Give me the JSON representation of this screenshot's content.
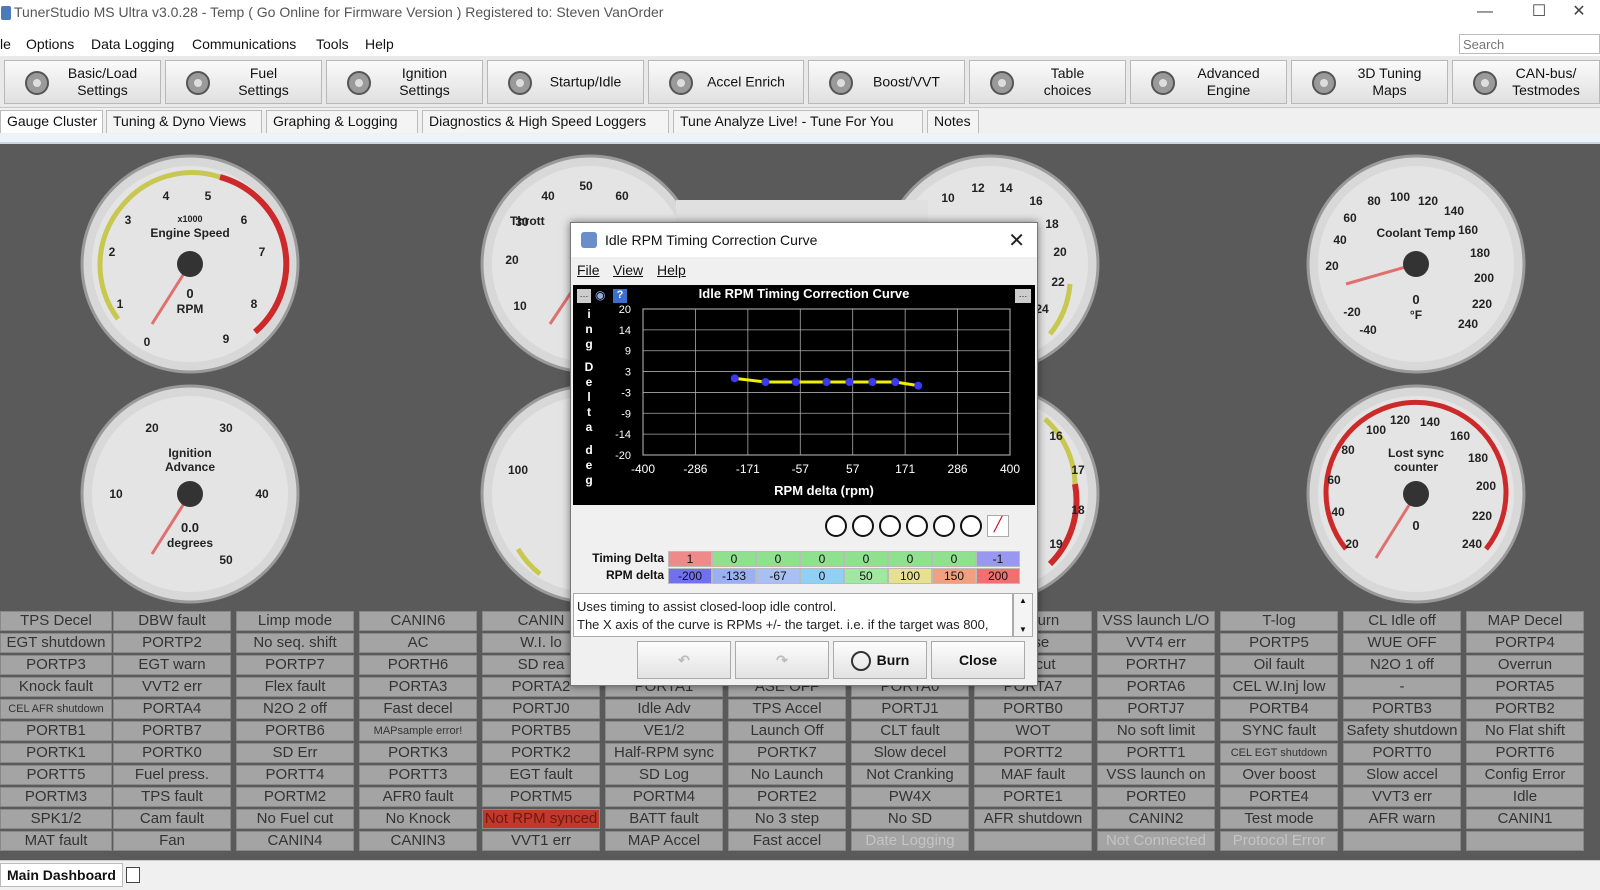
{
  "window": {
    "title": "TunerStudio MS Ultra v3.0.28 - Temp ( Go Online for Firmware Version ) Registered to: Steven VanOrder",
    "min": "—",
    "max": "☐",
    "close": "✕"
  },
  "menu": [
    "le",
    "Options",
    "Data Logging",
    "Communications",
    "Tools",
    "Help"
  ],
  "search": {
    "placeholder": "Search"
  },
  "toolbar": [
    {
      "l1": "Basic/Load",
      "l2": "Settings",
      "icon": "gear-icon"
    },
    {
      "l1": "Fuel",
      "l2": "Settings",
      "icon": "injector-icon"
    },
    {
      "l1": "Ignition",
      "l2": "Settings",
      "icon": "spark-plug-icon"
    },
    {
      "l1": "Startup/Idle",
      "l2": "",
      "icon": "wrench-icon"
    },
    {
      "l1": "Accel Enrich",
      "l2": "",
      "icon": "pedal-icon"
    },
    {
      "l1": "Boost/VVT",
      "l2": "",
      "icon": "turbo-icon"
    },
    {
      "l1": "Table",
      "l2": "choices",
      "icon": "tools-icon"
    },
    {
      "l1": "Advanced",
      "l2": "Engine",
      "icon": "gears-icon"
    },
    {
      "l1": "3D Tuning",
      "l2": "Maps",
      "icon": "hammer-icon"
    },
    {
      "l1": "CAN-bus/",
      "l2": "Testmodes",
      "icon": "gear-icon"
    }
  ],
  "tabs": [
    "Gauge Cluster",
    "Tuning & Dyno Views",
    "Graphing & Logging",
    "Diagnostics & High Speed Loggers",
    "Tune Analyze Live! - Tune For You",
    "Notes"
  ],
  "gauges": {
    "rpm": {
      "title": "Engine Speed",
      "mult": "x1000",
      "unit": "RPM",
      "value": "0",
      "ticks": [
        "0",
        "1",
        "2",
        "3",
        "4",
        "5",
        "6",
        "7",
        "8",
        "9"
      ]
    },
    "advance": {
      "title": "Ignition",
      "title2": "Advance",
      "unit": "degrees",
      "value": "0.0",
      "ticks": [
        "10",
        "20",
        "30",
        "40",
        "50"
      ]
    },
    "throttle": {
      "ticks": [
        "10",
        "20",
        "30",
        "40",
        "50",
        "60"
      ],
      "partial": "Thrott"
    },
    "mid2": {
      "ticks": [
        "100"
      ]
    },
    "afr": {
      "ticks": [
        "10",
        "12",
        "14",
        "16",
        "18",
        "20",
        "22",
        "24"
      ]
    },
    "afr2": {
      "ticks": [
        "16",
        "17",
        "18",
        "19"
      ]
    },
    "coolant": {
      "title": "Coolant Temp",
      "unit": "°F",
      "value": "0",
      "ticks": [
        "-40",
        "-20",
        "20",
        "40",
        "60",
        "80",
        "100",
        "120",
        "140",
        "160",
        "180",
        "200",
        "220",
        "240"
      ]
    },
    "lostsync": {
      "title": "Lost sync",
      "title2": "counter",
      "value": "0",
      "ticks": [
        "20",
        "40",
        "60",
        "80",
        "100",
        "120",
        "140",
        "160",
        "180",
        "200",
        "220",
        "240"
      ]
    }
  },
  "dialog": {
    "title": "Idle RPM Timing Correction Curve",
    "menu": [
      "File",
      "View",
      "Help"
    ],
    "chart_title": "Idle RPM Timing Correction Curve",
    "ylabel_chars": [
      "i",
      "n",
      "g",
      "D",
      "e",
      "l",
      "t",
      "a",
      "d",
      "e",
      "g"
    ],
    "desc_line1": "Uses timing to assist closed-loop idle control.",
    "desc_line2": "The X axis of the curve is RPMs +/- the target. i.e. if the target was 800,",
    "btn_burn": "Burn",
    "btn_close": "Close",
    "row1_label": "Timing Delta",
    "row2_label": "RPM delta",
    "row1": [
      "1",
      "0",
      "0",
      "0",
      "0",
      "0",
      "0",
      "-1"
    ],
    "row2": [
      "-200",
      "-133",
      "-67",
      "0",
      "50",
      "100",
      "150",
      "200"
    ],
    "row1_colors": [
      "#ee8a8a",
      "#8fe08f",
      "#8fe08f",
      "#8fe08f",
      "#8fe08f",
      "#8fe08f",
      "#8fe08f",
      "#9898f0"
    ],
    "row2_colors": [
      "#7070f0",
      "#9ab0f0",
      "#a8c0f4",
      "#90d0f4",
      "#a0e8a0",
      "#e6e090",
      "#f0a080",
      "#f07070"
    ]
  },
  "chart_data": {
    "type": "line",
    "title": "Idle RPM Timing Correction Curve",
    "xlabel": "RPM delta (rpm)",
    "ylabel": "Timing Delta deg",
    "x_ticks": [
      "-400",
      "-286",
      "-171",
      "-57",
      "57",
      "171",
      "286",
      "400"
    ],
    "y_ticks": [
      "20",
      "14",
      "9",
      "3",
      "-3",
      "-9",
      "-14",
      "-20"
    ],
    "xlim": [
      -400,
      400
    ],
    "ylim": [
      -20,
      20
    ],
    "x": [
      -200,
      -133,
      -67,
      0,
      50,
      100,
      150,
      200
    ],
    "y": [
      1,
      0,
      0,
      0,
      0,
      0,
      0,
      -1
    ],
    "series": [
      {
        "values": [
          1,
          0,
          0,
          0,
          0,
          0,
          0,
          -1
        ],
        "color": "#f0f000"
      }
    ]
  },
  "grid_cells": [
    [
      "TPS Decel",
      "EGT shutdown",
      "PORTP3",
      "Knock fault",
      "CEL AFR shutdown",
      "PORTB1",
      "PORTK1",
      "PORTT5",
      "PORTM3",
      "SPK1/2",
      "MAT fault"
    ],
    [
      "DBW fault",
      "PORTP2",
      "EGT warn",
      "VVT2 err",
      "PORTA4",
      "PORTB7",
      "PORTK0",
      "Fuel press.",
      "TPS fault",
      "Cam fault",
      "Fan"
    ],
    [
      "Limp mode",
      "No seq. shift",
      "PORTP7",
      "Flex fault",
      "N2O 2 off",
      "PORTB6",
      "SD Err",
      "PORTT4",
      "PORTM2",
      "No Fuel cut",
      "CANIN4"
    ],
    [
      "CANIN6",
      "AC",
      "PORTH6",
      "PORTA3",
      "Fast decel",
      "MAPsample error!",
      "PORTK3",
      "PORTT3",
      "AFR0 fault",
      "No Knock",
      "CANIN3"
    ],
    [
      "CANIN",
      "W.I. lo",
      "SD rea",
      "PORTA2",
      "PORTJ0",
      "PORTB5",
      "PORTK2",
      "EGT fault",
      "PORTM5",
      "Not RPM synced",
      "VVT1 err"
    ],
    [
      "",
      "",
      "",
      "PORTA1",
      "Idle Adv",
      "VE1/2",
      "Half-RPM sync",
      "SD Log",
      "PORTM4",
      "BATT fault",
      "MAP Accel"
    ],
    [
      "",
      "",
      "",
      "ASE OFF",
      "TPS Accel",
      "Launch Off",
      "PORTK7",
      "No Launch",
      "PORTE2",
      "No 3 step",
      "Fast accel"
    ],
    [
      "",
      "",
      "",
      "PORTA0",
      "PORTJ1",
      "CLT fault",
      "Slow decel",
      "Not Cranking",
      "PW4X",
      "No SD",
      "Date Logging"
    ],
    [
      "ed Burn",
      "ruise",
      "ark cut",
      "PORTA7",
      "PORTB0",
      "WOT",
      "PORTT2",
      "MAF fault",
      "PORTE1",
      "AFR shutdown",
      ""
    ],
    [
      "VSS launch L/O",
      "VVT4 err",
      "PORTH7",
      "PORTA6",
      "PORTJ7",
      "No soft limit",
      "PORTT1",
      "VSS launch on",
      "PORTE0",
      "CANIN2",
      "Not Connected"
    ],
    [
      "T-log",
      "PORTP5",
      "Oil fault",
      "CEL W.Inj low",
      "PORTB4",
      "SYNC fault",
      "CEL EGT shutdown",
      "Over boost",
      "PORTE4",
      "Test mode",
      "Protocol Error"
    ],
    [
      "CL Idle off",
      "WUE OFF",
      "N2O 1 off",
      "-",
      "PORTB3",
      "Safety shutdown",
      "PORTT0",
      "Slow accel",
      "VVT3 err",
      "AFR warn",
      ""
    ],
    [
      "MAP Decel",
      "PORTP4",
      "Overrun",
      "PORTA5",
      "PORTB2",
      "No Flat shift",
      "PORTT6",
      "Config Error",
      "Idle",
      "CANIN1",
      ""
    ]
  ],
  "bottom": {
    "tab": "Main Dashboard"
  }
}
